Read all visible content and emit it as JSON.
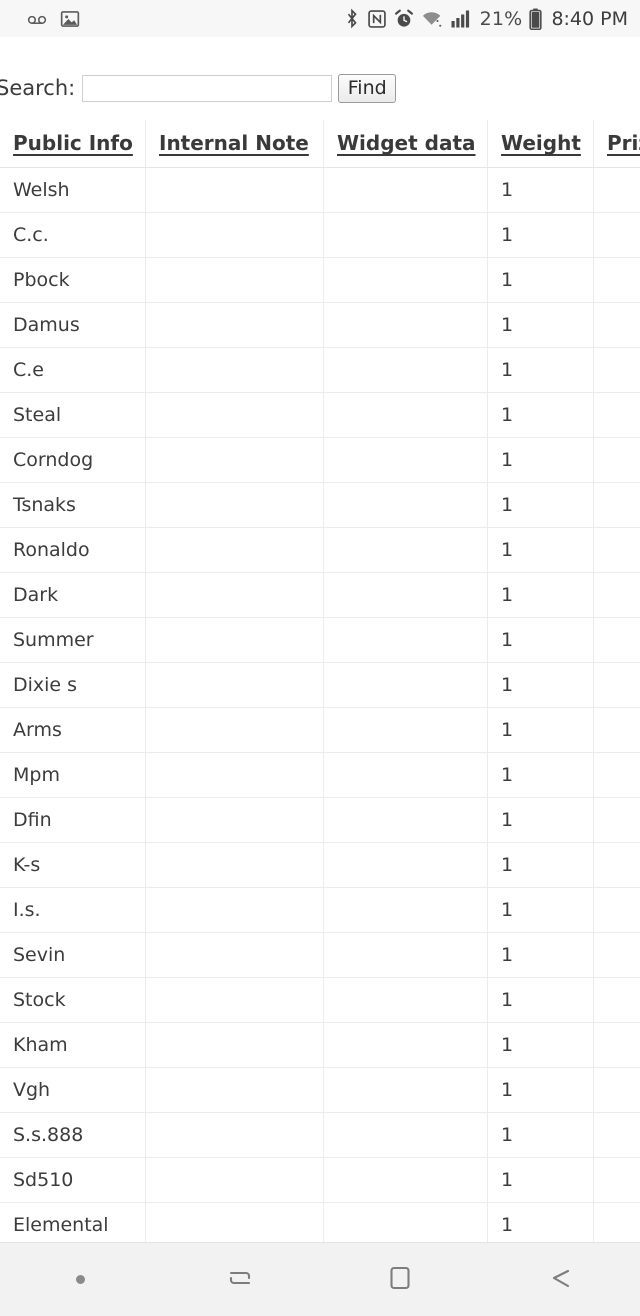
{
  "statusbar": {
    "left_icons": [
      {
        "name": "voicemail-icon"
      },
      {
        "name": "image-icon"
      }
    ],
    "right_icons": [
      {
        "name": "bluetooth-icon"
      },
      {
        "name": "nfc-icon"
      },
      {
        "name": "alarm-icon"
      },
      {
        "name": "wifi-icon"
      },
      {
        "name": "cell-signal-icon"
      }
    ],
    "battery_percent": "21%",
    "battery_icon": "battery-icon",
    "time": "8:40 PM"
  },
  "search": {
    "label": "Search:",
    "value": "",
    "placeholder": "",
    "button_label": "Find"
  },
  "table": {
    "headers": [
      "Public Info",
      "Internal Note",
      "Widget data",
      "Weight",
      "Prize"
    ],
    "rows": [
      {
        "public_info": "Welsh",
        "internal_note": "",
        "widget_data": "",
        "weight": "1",
        "prize": ""
      },
      {
        "public_info": "C.c.",
        "internal_note": "",
        "widget_data": "",
        "weight": "1",
        "prize": ""
      },
      {
        "public_info": "Pbock",
        "internal_note": "",
        "widget_data": "",
        "weight": "1",
        "prize": ""
      },
      {
        "public_info": "Damus",
        "internal_note": "",
        "widget_data": "",
        "weight": "1",
        "prize": ""
      },
      {
        "public_info": "C.e",
        "internal_note": "",
        "widget_data": "",
        "weight": "1",
        "prize": ""
      },
      {
        "public_info": "Steal",
        "internal_note": "",
        "widget_data": "",
        "weight": "1",
        "prize": ""
      },
      {
        "public_info": "Corndog",
        "internal_note": "",
        "widget_data": "",
        "weight": "1",
        "prize": ""
      },
      {
        "public_info": "Tsnaks",
        "internal_note": "",
        "widget_data": "",
        "weight": "1",
        "prize": ""
      },
      {
        "public_info": "Ronaldo",
        "internal_note": "",
        "widget_data": "",
        "weight": "1",
        "prize": ""
      },
      {
        "public_info": "Dark",
        "internal_note": "",
        "widget_data": "",
        "weight": "1",
        "prize": ""
      },
      {
        "public_info": "Summer",
        "internal_note": "",
        "widget_data": "",
        "weight": "1",
        "prize": ""
      },
      {
        "public_info": "Dixie s",
        "internal_note": "",
        "widget_data": "",
        "weight": "1",
        "prize": ""
      },
      {
        "public_info": "Arms",
        "internal_note": "",
        "widget_data": "",
        "weight": "1",
        "prize": ""
      },
      {
        "public_info": "Mpm",
        "internal_note": "",
        "widget_data": "",
        "weight": "1",
        "prize": ""
      },
      {
        "public_info": "Dfin",
        "internal_note": "",
        "widget_data": "",
        "weight": "1",
        "prize": ""
      },
      {
        "public_info": "K-s",
        "internal_note": "",
        "widget_data": "",
        "weight": "1",
        "prize": ""
      },
      {
        "public_info": "I.s.",
        "internal_note": "",
        "widget_data": "",
        "weight": "1",
        "prize": ""
      },
      {
        "public_info": "Sevin",
        "internal_note": "",
        "widget_data": "",
        "weight": "1",
        "prize": ""
      },
      {
        "public_info": "Stock",
        "internal_note": "",
        "widget_data": "",
        "weight": "1",
        "prize": ""
      },
      {
        "public_info": "Kham",
        "internal_note": "",
        "widget_data": "",
        "weight": "1",
        "prize": ""
      },
      {
        "public_info": "Vgh",
        "internal_note": "",
        "widget_data": "",
        "weight": "1",
        "prize": ""
      },
      {
        "public_info": "S.s.888",
        "internal_note": "",
        "widget_data": "",
        "weight": "1",
        "prize": ""
      },
      {
        "public_info": "Sd510",
        "internal_note": "",
        "widget_data": "",
        "weight": "1",
        "prize": ""
      },
      {
        "public_info": "Elemental",
        "internal_note": "",
        "widget_data": "",
        "weight": "1",
        "prize": ""
      }
    ]
  },
  "navbar": {
    "items": [
      {
        "name": "nav-dot-indicator"
      },
      {
        "name": "recents-icon"
      },
      {
        "name": "home-icon"
      },
      {
        "name": "back-icon"
      }
    ]
  },
  "colors": {
    "page_bg": "#ffffff",
    "statusbar_bg": "#f7f7f7",
    "navbar_bg": "#f2f2f2",
    "grid_line": "#ececec",
    "text": "#3c3c3c"
  }
}
